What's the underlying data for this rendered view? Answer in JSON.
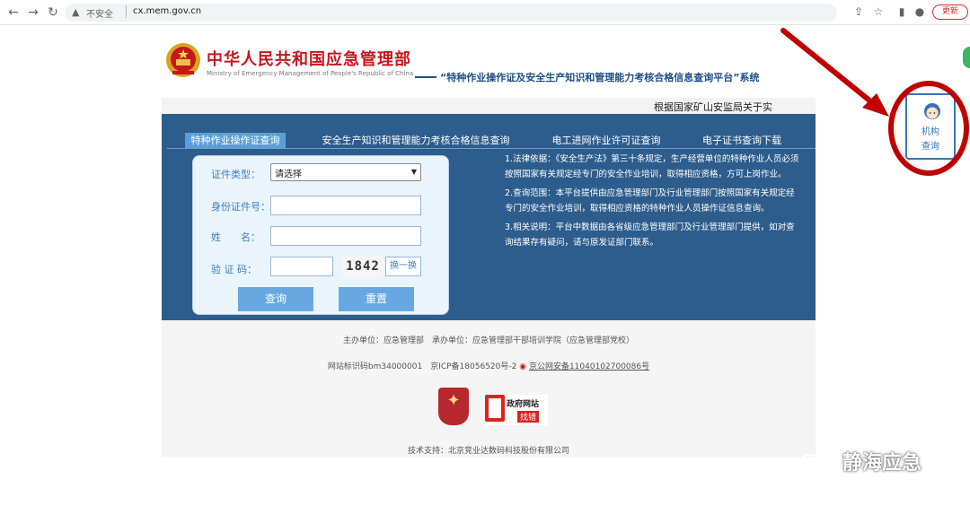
{
  "browser": {
    "security_label": "不安全",
    "url": "cx.mem.gov.cn",
    "update_label": "更新"
  },
  "header": {
    "org_name": "中华人民共和国应急管理部",
    "org_name_en": "Ministry of Emergency Management of People's Republic of China",
    "platform_title": "“特种作业操作证及安全生产知识和管理能力考核合格信息查询平台”系统"
  },
  "notice": {
    "text": "根据国家矿山安监局关于实"
  },
  "tabs": [
    {
      "label": "特种作业操作证查询",
      "active": true
    },
    {
      "label": "安全生产知识和管理能力考核合格信息查询",
      "active": false
    },
    {
      "label": "电工进网作业许可证查询",
      "active": false
    },
    {
      "label": "电子证书查询下载",
      "active": false
    }
  ],
  "form": {
    "cert_type_label": "证件类型：",
    "cert_type_value": "请选择",
    "id_label": "身份证件号：",
    "name_label": "姓　　名：",
    "captcha_label": "验 证 码：",
    "captcha_code": "1842",
    "captcha_refresh": "换一换",
    "query_button": "查询",
    "reset_button": "重置"
  },
  "info": [
    "1.法律依据：《安全生产法》第三十条规定，生产经营单位的特种作业人员必须按照国家有关规定经专门的安全作业培训，取得相应资格，方可上岗作业。",
    "2.查询范围：本平台提供由应急管理部门及行业管理部门按照国家有关规定经专门的安全作业培训，取得相应资格的特种作业人员操作证信息查询。",
    "3.相关说明：平台中数据由各省级应急管理部门及行业管理部门提供，如对查询结果存有疑问，请与原发证部门联系。"
  ],
  "footer": {
    "sponsor": "主办单位：应急管理部　承办单位：应急管理部干部培训学院（应急管理部党校）",
    "site_id": "网站标识码bm34000001　京ICP备18056520号-2",
    "police_record": "京公网安备11040102700086号",
    "gov_find_title": "政府网站",
    "gov_find_sub": "找错",
    "tech_support": "技术支持：北京竞业达数码科技股份有限公司"
  },
  "side_float": {
    "line1": "机构",
    "line2": "查询"
  },
  "watermark": "静海应急",
  "colors": {
    "brand_red": "#c8161d",
    "panel_blue": "#2d5d8d",
    "tab_active": "#5c9fd6",
    "annotation_red": "#c00000"
  }
}
